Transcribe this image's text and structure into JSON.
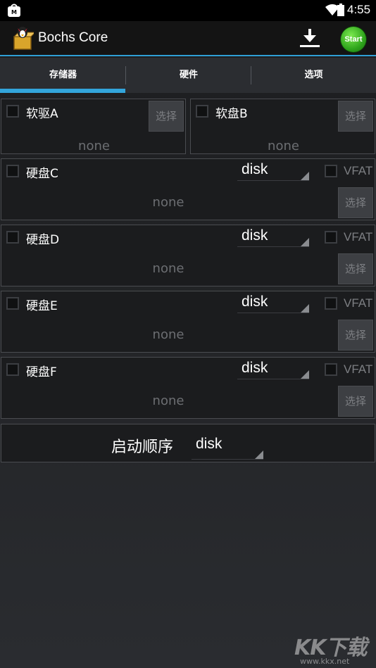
{
  "status_bar": {
    "time": "4:55"
  },
  "action_bar": {
    "title": "Bochs Core",
    "start_label": "Start"
  },
  "tabs": [
    {
      "label": "存储器",
      "selected": true
    },
    {
      "label": "硬件",
      "selected": false
    },
    {
      "label": "选项",
      "selected": false
    }
  ],
  "floppy": [
    {
      "label": "软驱A",
      "path": "none",
      "select_label": "选择",
      "checked": false
    },
    {
      "label": "软盘B",
      "path": "none",
      "select_label": "选择",
      "checked": false
    }
  ],
  "hdd": [
    {
      "label": "硬盘C",
      "type": "disk",
      "vfat_label": "VFAT",
      "path": "none",
      "select_label": "选择",
      "checked": false
    },
    {
      "label": "硬盘D",
      "type": "disk",
      "vfat_label": "VFAT",
      "path": "none",
      "select_label": "选择",
      "checked": false
    },
    {
      "label": "硬盘E",
      "type": "disk",
      "vfat_label": "VFAT",
      "path": "none",
      "select_label": "选择",
      "checked": false
    },
    {
      "label": "硬盘F",
      "type": "disk",
      "vfat_label": "VFAT",
      "path": "none",
      "select_label": "选择",
      "checked": false
    }
  ],
  "boot": {
    "label": "启动顺序",
    "value": "disk"
  },
  "watermark": {
    "logo_text": "KK下载",
    "url": "www.kkx.net"
  },
  "colors": {
    "accent": "#33a5db",
    "start_button": "#2fa51c"
  }
}
